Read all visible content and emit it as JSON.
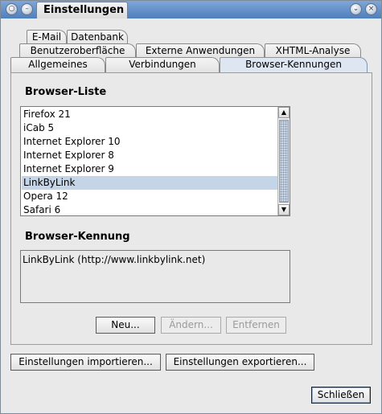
{
  "window": {
    "title": "Einstellungen",
    "menu_icon": "window-menu-icon",
    "minimize_icon": "minimize-icon",
    "close_icon": "close-icon"
  },
  "tabs": {
    "row1": [
      "E-Mail",
      "Datenbank"
    ],
    "row2": [
      "Benutzeroberfläche",
      "Externe Anwendungen",
      "XHTML-Analyse"
    ],
    "row3": [
      "Allgemeines",
      "Verbindungen",
      "Browser-Kennungen"
    ],
    "active": "Browser-Kennungen"
  },
  "browser_list": {
    "label": "Browser-Liste",
    "items": [
      "Firefox 21",
      "iCab 5",
      "Internet Explorer 10",
      "Internet Explorer 8",
      "Internet Explorer 9",
      "LinkByLink",
      "Opera 12",
      "Safari 6"
    ],
    "selected": "LinkByLink"
  },
  "browser_id": {
    "label": "Browser-Kennung",
    "value": "LinkByLink (http://www.linkbylink.net)"
  },
  "buttons": {
    "new": "Neu...",
    "edit": "Ändern...",
    "remove": "Entfernen",
    "import": "Einstellungen importieren...",
    "export": "Einstellungen exportieren...",
    "close": "Schließen"
  },
  "colors": {
    "titlebar": "#5a88c4",
    "selection": "#c5d5e8",
    "active_tab": "#dde6f1",
    "background": "#e9e9e9"
  }
}
